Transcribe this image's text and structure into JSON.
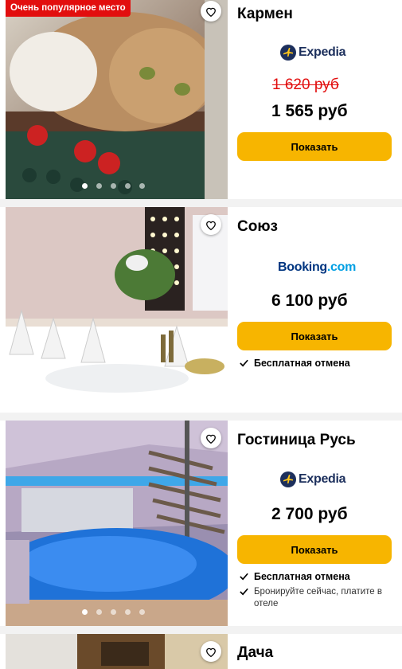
{
  "listings": [
    {
      "name": "Кармен",
      "badge": "Очень популярное место",
      "provider": "Expedia",
      "old_price": "1 620 руб",
      "price": "1 565 руб",
      "button": "Показать",
      "features": []
    },
    {
      "name": "Союз",
      "provider": "Booking.com",
      "provider_parts": [
        "Booking",
        ".com"
      ],
      "price": "6 100 руб",
      "button": "Показать",
      "features": [
        "Бесплатная отмена"
      ]
    },
    {
      "name": "Гостиница Русь",
      "provider": "Expedia",
      "price": "2 700 руб",
      "button": "Показать",
      "features": [
        "Бесплатная отмена",
        "Бронируйте сейчас, платите в отеле"
      ]
    },
    {
      "name": "Дача"
    }
  ],
  "colors": {
    "button": "#f7b500",
    "badge": "#e20e0e",
    "old_price": "#e20e0e",
    "booking_blue": "#003580",
    "booking_light": "#009fe3",
    "expedia_navy": "#1c2f5c",
    "expedia_yellow": "#fcc419"
  },
  "icons": [
    "heart-icon",
    "check-icon",
    "expedia-plane-icon"
  ]
}
